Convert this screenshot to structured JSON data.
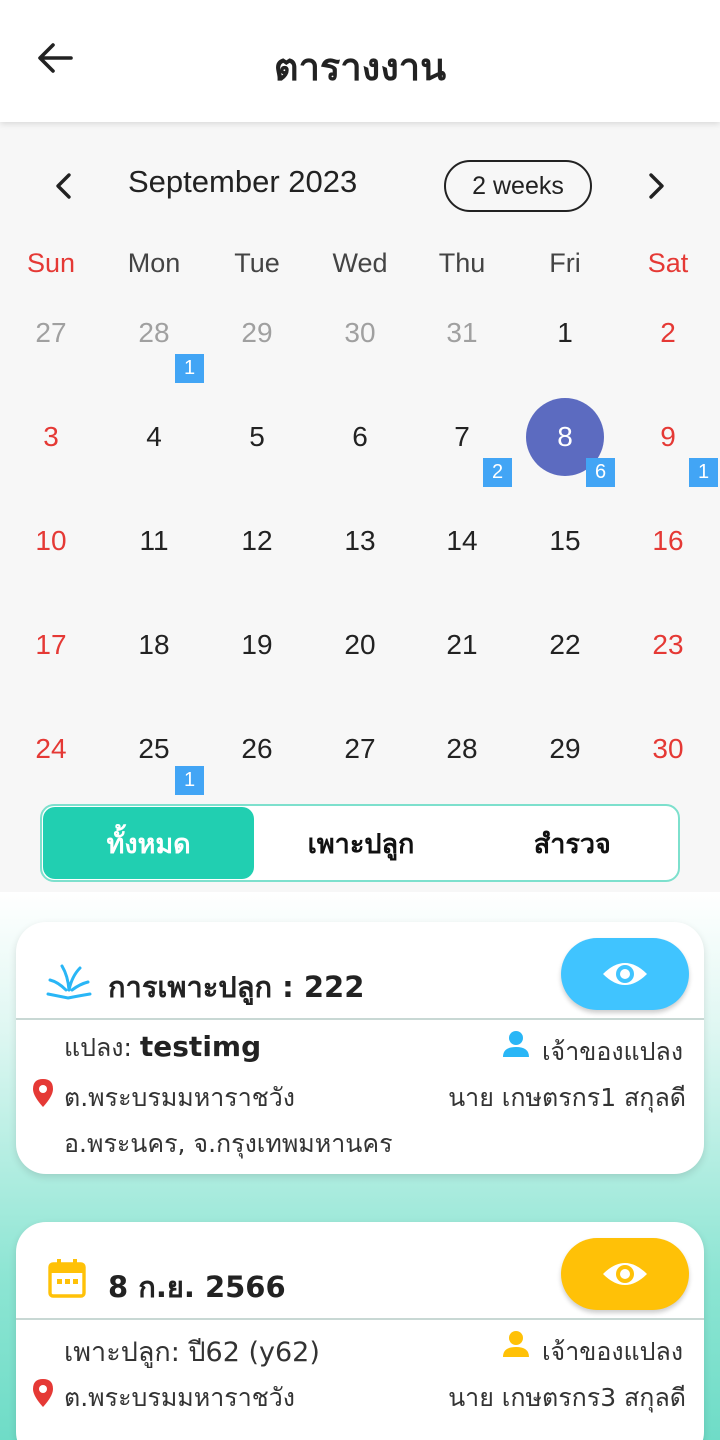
{
  "app_bar": {
    "title": "ตารางงาน"
  },
  "calendar": {
    "month_title": "September 2023",
    "format_button": "2 weeks",
    "weekdays": [
      "Sun",
      "Mon",
      "Tue",
      "Wed",
      "Thu",
      "Fri",
      "Sat"
    ],
    "weeks": [
      [
        "27",
        "28",
        "29",
        "30",
        "31",
        "1",
        "2"
      ],
      [
        "3",
        "4",
        "5",
        "6",
        "7",
        "8",
        "9"
      ],
      [
        "10",
        "11",
        "12",
        "13",
        "14",
        "15",
        "16"
      ],
      [
        "17",
        "18",
        "19",
        "20",
        "21",
        "22",
        "23"
      ],
      [
        "24",
        "25",
        "26",
        "27",
        "28",
        "29",
        "30"
      ]
    ],
    "selected_day": "8",
    "event_markers": [
      {
        "day": "28",
        "count": "1"
      },
      {
        "day": "7",
        "count": "2"
      },
      {
        "day": "8",
        "count": "6"
      },
      {
        "day": "9",
        "count": "1"
      },
      {
        "day": "25",
        "count": "1"
      }
    ]
  },
  "filter_tabs": {
    "all": "ทั้งหมด",
    "planting": "เพาะปลูก",
    "survey": "สำรวจ",
    "active": "all"
  },
  "cards": [
    {
      "title": "การเพาะปลูก : 222",
      "plot_label": "แปลง:",
      "plot_name": "testimg",
      "owner_label": "เจ้าของแปลง",
      "address_line1": "ต.พระบรมมหาราชวัง",
      "address_line2": "อ.พระนคร, จ.กรุงเทพมหานคร",
      "owner_name": "นาย เกษตรกร1 สกุลดี"
    },
    {
      "title": "8 ก.ย. 2566",
      "crop_text": "เพาะปลูก: ปี62 (y62)",
      "owner_label": "เจ้าของแปลง",
      "address_line1": "ต.พระบรมมหาราชวัง",
      "owner_name": "นาย เกษตรกร3 สกุลดี"
    }
  ],
  "colors": {
    "selected_day": "#5c6bc0",
    "marker": "#42a5f5",
    "weekend": "#e53935",
    "tab_active": "#21cfb1",
    "view_btn_blue": "#40c4ff",
    "view_btn_yellow": "#ffc107",
    "location_pin": "#e53935"
  }
}
